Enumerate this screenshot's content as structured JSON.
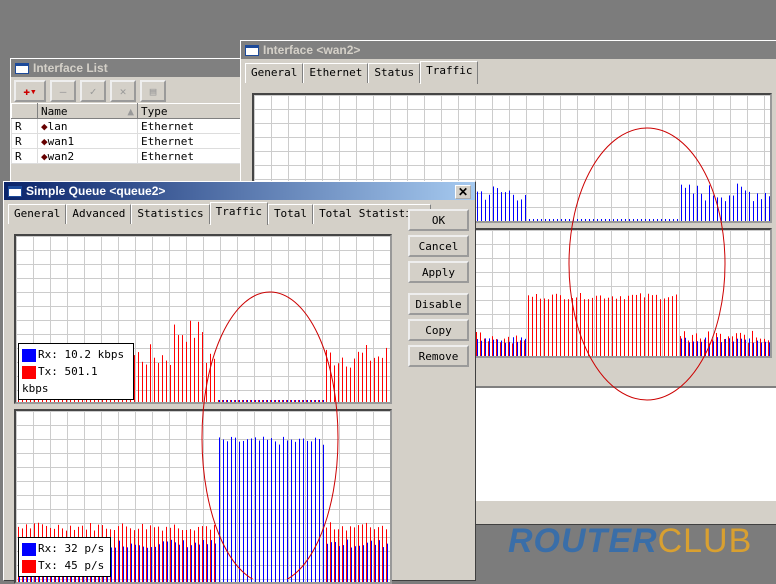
{
  "interface_list": {
    "title": "Interface List",
    "columns": [
      "",
      "Name",
      "Type"
    ],
    "rows": [
      {
        "flag": "R",
        "name": "lan",
        "type": "Ethernet"
      },
      {
        "flag": "R",
        "name": "wan1",
        "type": "Ethernet"
      },
      {
        "flag": "R",
        "name": "wan2",
        "type": "Ethernet"
      }
    ]
  },
  "interface_win": {
    "title": "Interface <wan2>",
    "tabs": [
      "General",
      "Ethernet",
      "Status",
      "Traffic"
    ],
    "selected_tab": "Traffic"
  },
  "queue_win": {
    "title": "Simple Queue <queue2>",
    "tabs": [
      "General",
      "Advanced",
      "Statistics",
      "Traffic",
      "Total",
      "Total Statistics"
    ],
    "selected_tab": "Traffic",
    "buttons": {
      "ok": "OK",
      "cancel": "Cancel",
      "apply": "Apply",
      "disable": "Disable",
      "copy": "Copy",
      "remove": "Remove"
    },
    "bits_legend": {
      "rx": "Rx: 10.2 kbps",
      "tx": "Tx: 501.1 kbps"
    },
    "packets_legend": {
      "rx": "Rx: 32 p/s",
      "tx": "Tx: 45 p/s"
    }
  },
  "colors": {
    "rx": "#0000ff",
    "tx": "#ff0000",
    "annotation": "#cc0000"
  },
  "watermark": "ROUTERCLUB"
}
